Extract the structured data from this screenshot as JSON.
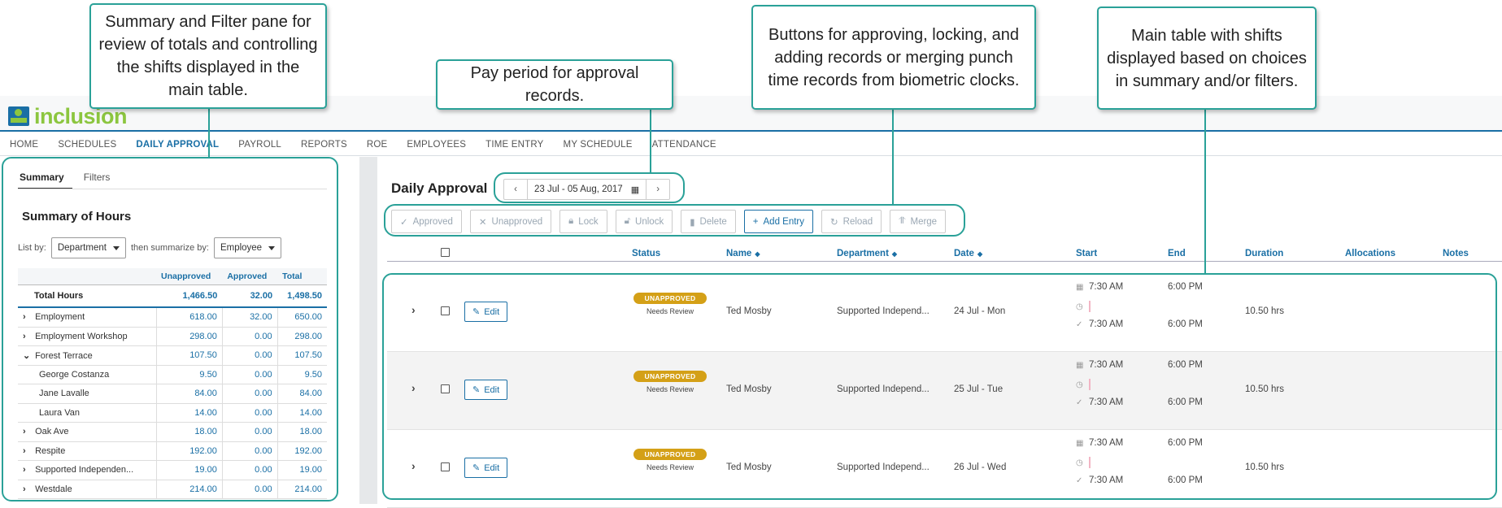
{
  "app": {
    "logo_text": "inclusion"
  },
  "nav": [
    "HOME",
    "SCHEDULES",
    "DAILY APPROVAL",
    "PAYROLL",
    "REPORTS",
    "ROE",
    "EMPLOYEES",
    "TIME ENTRY",
    "MY SCHEDULE",
    "ATTENDANCE"
  ],
  "left": {
    "tabs": [
      "Summary",
      "Filters"
    ],
    "title": "Summary of Hours",
    "list_by_label": "List by:",
    "list_by_value": "Department",
    "then_label": "then summarize by:",
    "then_value": "Employee",
    "columns": [
      "Unapproved",
      "Approved",
      "Total"
    ],
    "total": {
      "label": "Total Hours",
      "unapproved": "1,466.50",
      "approved": "32.00",
      "total": "1,498.50"
    },
    "rows": [
      {
        "label": "Employment",
        "unapproved": "618.00",
        "approved": "32.00",
        "total": "650.00",
        "chevron": "›"
      },
      {
        "label": "Employment Workshop",
        "unapproved": "298.00",
        "approved": "0.00",
        "total": "298.00",
        "chevron": "›"
      },
      {
        "label": "Forest Terrace",
        "unapproved": "107.50",
        "approved": "0.00",
        "total": "107.50",
        "chevron": "⌄"
      },
      {
        "label": "George Costanza",
        "unapproved": "9.50",
        "approved": "0.00",
        "total": "9.50",
        "chevron": ""
      },
      {
        "label": "Jane Lavalle",
        "unapproved": "84.00",
        "approved": "0.00",
        "total": "84.00",
        "chevron": ""
      },
      {
        "label": "Laura Van",
        "unapproved": "14.00",
        "approved": "0.00",
        "total": "14.00",
        "chevron": ""
      },
      {
        "label": "Oak Ave",
        "unapproved": "18.00",
        "approved": "0.00",
        "total": "18.00",
        "chevron": "›"
      },
      {
        "label": "Respite",
        "unapproved": "192.00",
        "approved": "0.00",
        "total": "192.00",
        "chevron": "›"
      },
      {
        "label": "Supported Independen...",
        "unapproved": "19.00",
        "approved": "0.00",
        "total": "19.00",
        "chevron": "›"
      },
      {
        "label": "Westdale",
        "unapproved": "214.00",
        "approved": "0.00",
        "total": "214.00",
        "chevron": "›"
      }
    ]
  },
  "main": {
    "title": "Daily Approval",
    "pay_period": "23 Jul - 05 Aug, 2017",
    "toolbar": {
      "approved": "Approved",
      "unapproved": "Unapproved",
      "lock": "Lock",
      "unlock": "Unlock",
      "delete": "Delete",
      "add_entry": "Add Entry",
      "reload": "Reload",
      "merge": "Merge"
    },
    "columns": {
      "status": "Status",
      "name": "Name",
      "department": "Department",
      "date": "Date",
      "start": "Start",
      "end": "End",
      "duration": "Duration",
      "allocations": "Allocations",
      "notes": "Notes"
    },
    "edit_label": "Edit",
    "rows": [
      {
        "status": "UNAPPROVED",
        "status_sub": "Needs Review",
        "name": "Ted Mosby",
        "department": "Supported Independ...",
        "date": "24 Jul - Mon",
        "start_sched": "7:30 AM",
        "end_sched": "6:00 PM",
        "start_actual": "7:30 AM",
        "end_actual": "6:00 PM",
        "duration": "10.50 hrs"
      },
      {
        "status": "UNAPPROVED",
        "status_sub": "Needs Review",
        "name": "Ted Mosby",
        "department": "Supported Independ...",
        "date": "25 Jul - Tue",
        "start_sched": "7:30 AM",
        "end_sched": "6:00 PM",
        "start_actual": "7:30 AM",
        "end_actual": "6:00 PM",
        "duration": "10.50 hrs"
      },
      {
        "status": "UNAPPROVED",
        "status_sub": "Needs Review",
        "name": "Ted Mosby",
        "department": "Supported Independ...",
        "date": "26 Jul - Wed",
        "start_sched": "7:30 AM",
        "end_sched": "6:00 PM",
        "start_actual": "7:30 AM",
        "end_actual": "6:00 PM",
        "duration": "10.50 hrs"
      }
    ]
  },
  "callouts": {
    "summary": "Summary and Filter pane for review of totals and controlling the shifts displayed in the main table.",
    "pay_period": "Pay period for approval records.",
    "buttons": "Buttons for approving, locking, and adding records or merging punch time records from biometric clocks.",
    "table": "Main table with shifts displayed based on choices in summary and/or filters."
  },
  "colors": {
    "accent": "#1a6fa5",
    "logo_green": "#8cc63f",
    "callout": "#2aa198",
    "badge": "#d4a017"
  }
}
